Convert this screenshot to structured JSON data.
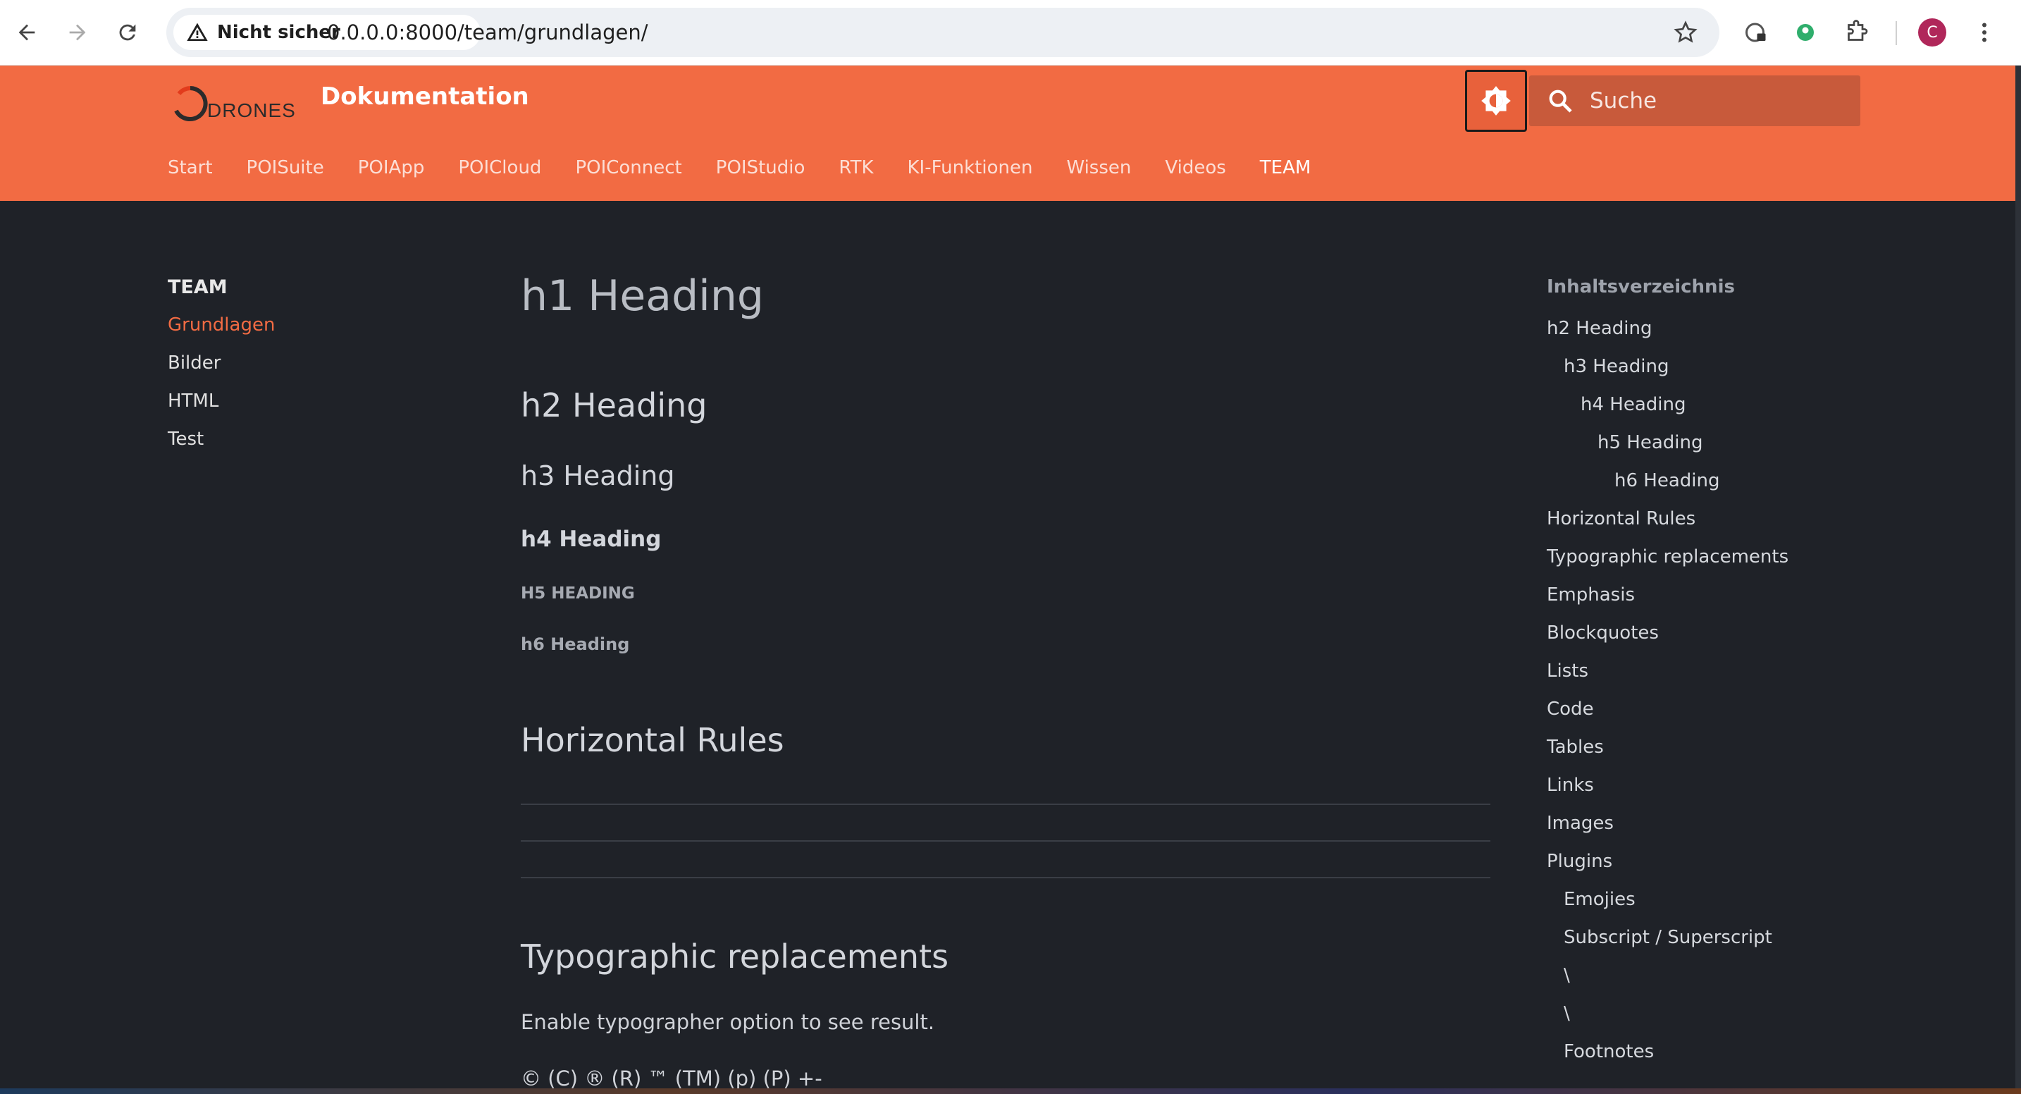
{
  "browser": {
    "security_label": "Nicht sicher",
    "url": "0.0.0.0:8000/team/grundlagen/",
    "profile_initial": "C"
  },
  "header": {
    "logo_text": "DRONES",
    "site_title": "Dokumentation",
    "search_placeholder": "Suche",
    "tabs": [
      {
        "label": "Start"
      },
      {
        "label": "POISuite"
      },
      {
        "label": "POIApp"
      },
      {
        "label": "POICloud"
      },
      {
        "label": "POIConnect"
      },
      {
        "label": "POIStudio"
      },
      {
        "label": "RTK"
      },
      {
        "label": "KI-Funktionen"
      },
      {
        "label": "Wissen"
      },
      {
        "label": "Videos"
      },
      {
        "label": "TEAM",
        "active": true
      }
    ]
  },
  "sidebar": {
    "title": "TEAM",
    "items": [
      {
        "label": "Grundlagen",
        "active": true
      },
      {
        "label": "Bilder"
      },
      {
        "label": "HTML"
      },
      {
        "label": "Test"
      }
    ]
  },
  "main": {
    "h1": "h1 Heading",
    "h2": "h2 Heading",
    "h3": "h3 Heading",
    "h4": "h4 Heading",
    "h5": "h5 Heading",
    "h6": "h6 Heading",
    "horizontal_rules": "Horizontal Rules",
    "typographic_replacements": "Typographic replacements",
    "typographer_note": "Enable typographer option to see result.",
    "symbols_line": "© (C) ® (R) ™ (TM) (p) (P) +-"
  },
  "toc": {
    "title": "Inhaltsverzeichnis",
    "items": [
      {
        "label": "h2 Heading",
        "level": 1
      },
      {
        "label": "h3 Heading",
        "level": 2
      },
      {
        "label": "h4 Heading",
        "level": 3
      },
      {
        "label": "h5 Heading",
        "level": 4
      },
      {
        "label": "h6 Heading",
        "level": 5
      },
      {
        "label": "Horizontal Rules",
        "level": 1
      },
      {
        "label": "Typographic replacements",
        "level": 1
      },
      {
        "label": "Emphasis",
        "level": 1
      },
      {
        "label": "Blockquotes",
        "level": 1
      },
      {
        "label": "Lists",
        "level": 1
      },
      {
        "label": "Code",
        "level": 1
      },
      {
        "label": "Tables",
        "level": 1
      },
      {
        "label": "Links",
        "level": 1
      },
      {
        "label": "Images",
        "level": 1
      },
      {
        "label": "Plugins",
        "level": 1
      },
      {
        "label": "Emojies",
        "level": 2
      },
      {
        "label": "Subscript / Superscript",
        "level": 2
      },
      {
        "label": "\\",
        "level": 2
      },
      {
        "label": "\\",
        "level": 2
      },
      {
        "label": "Footnotes",
        "level": 2
      }
    ]
  },
  "colors": {
    "accent": "#f26b43",
    "background": "#1f2228"
  }
}
